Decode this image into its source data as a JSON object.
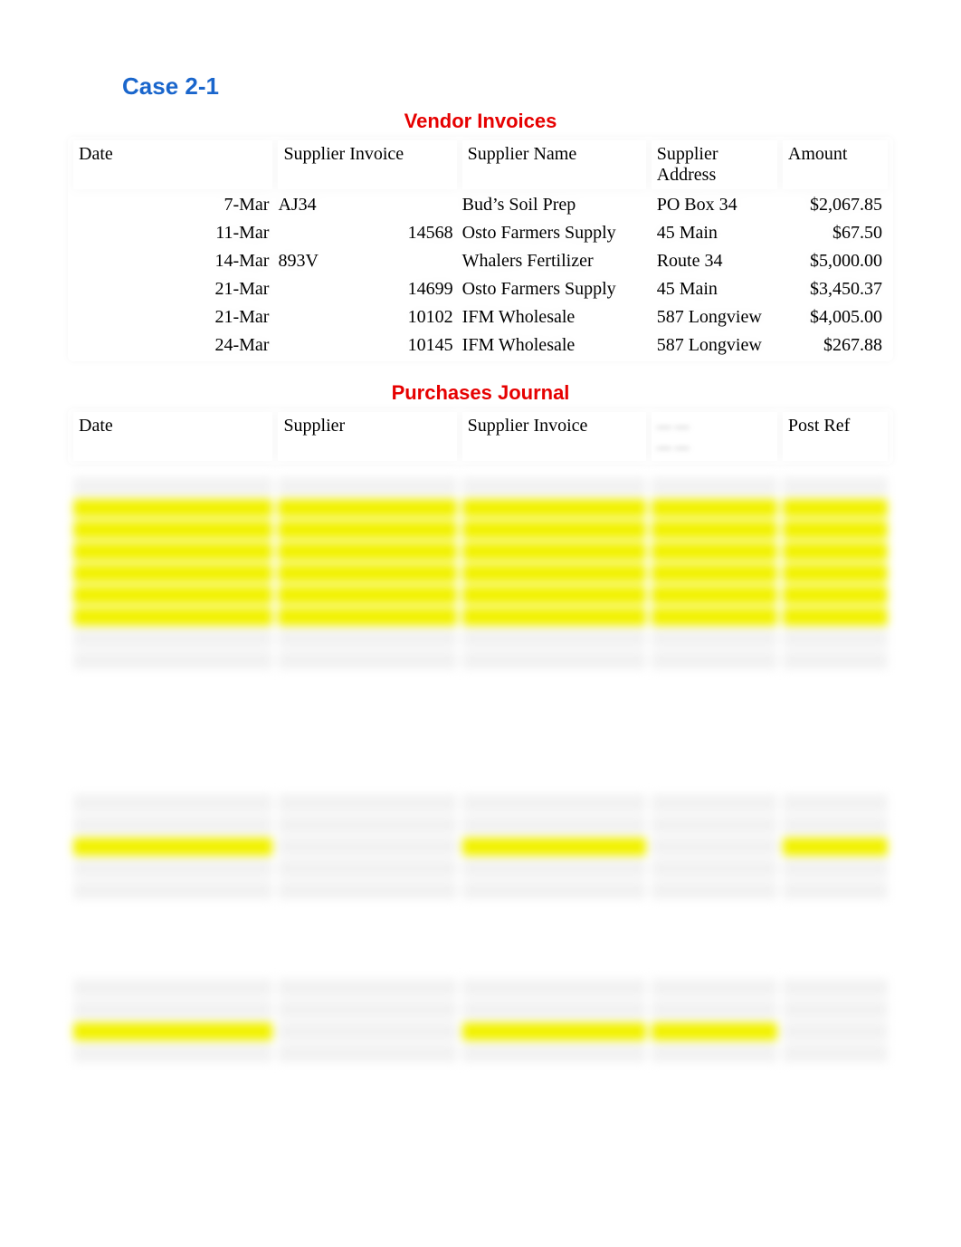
{
  "case_title": "Case 2-1",
  "sections": {
    "vendor_invoices": {
      "title": "Vendor Invoices",
      "headers": {
        "date": "Date",
        "invoice": "Supplier Invoice",
        "name": "Supplier Name",
        "address": "Supplier Address",
        "amount": "Amount"
      },
      "rows": [
        {
          "date": "7-Mar",
          "invoice": "AJ34",
          "name": "Bud’s Soil Prep",
          "address": "PO Box 34",
          "amount": "$2,067.85"
        },
        {
          "date": "11-Mar",
          "invoice": "14568",
          "name": "Osto Farmers Supply",
          "address": "45 Main",
          "amount": "$67.50"
        },
        {
          "date": "14-Mar",
          "invoice": "893V",
          "name": "Whalers Fertilizer",
          "address": "Route 34",
          "amount": "$5,000.00"
        },
        {
          "date": "21-Mar",
          "invoice": "14699",
          "name": "Osto Farmers Supply",
          "address": "45 Main",
          "amount": "$3,450.37"
        },
        {
          "date": "21-Mar",
          "invoice": "10102",
          "name": "IFM Wholesale",
          "address": "587 Longview",
          "amount": "$4,005.00"
        },
        {
          "date": "24-Mar",
          "invoice": "10145",
          "name": "IFM Wholesale",
          "address": "587 Longview",
          "amount": "$267.88"
        }
      ]
    },
    "purchases_journal": {
      "title": "Purchases Journal",
      "headers": {
        "date": "Date",
        "supplier": "Supplier",
        "invoice": "Supplier Invoice",
        "col4": "",
        "postref": "Post Ref"
      }
    }
  }
}
